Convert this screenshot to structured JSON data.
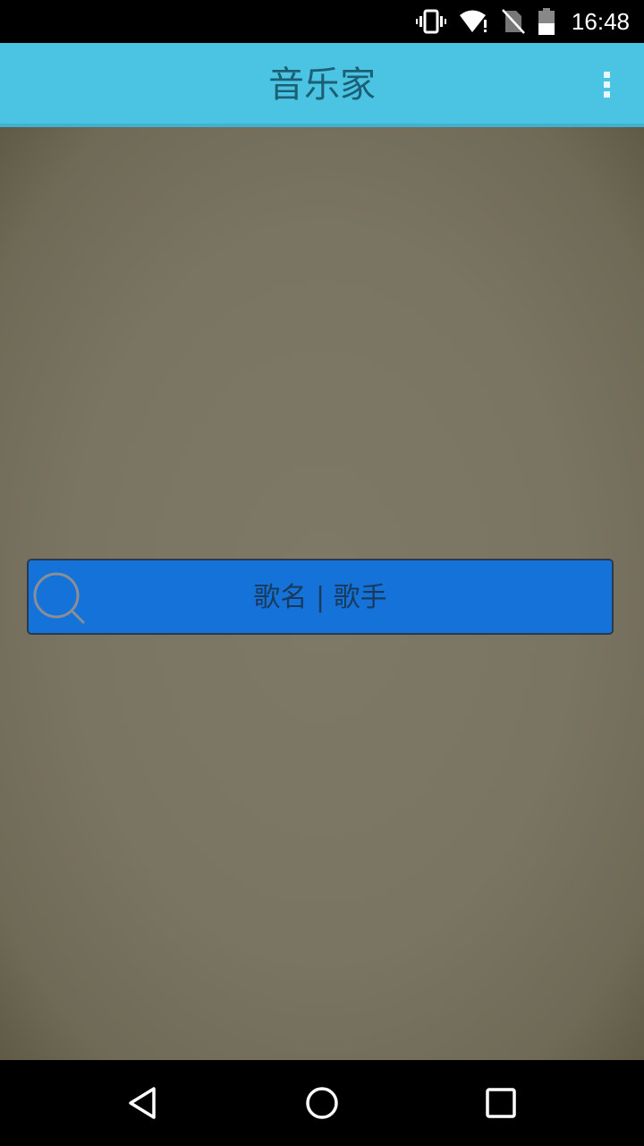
{
  "status_bar": {
    "time": "16:48",
    "icons": [
      "vibrate-icon",
      "wifi-alert-icon",
      "no-sim-icon",
      "battery-icon"
    ]
  },
  "app_bar": {
    "title": "音乐家",
    "menu_icon": "more-vert-icon"
  },
  "search": {
    "placeholder": "歌名 | 歌手",
    "icon": "search-icon"
  },
  "nav_bar": {
    "buttons": [
      "back-icon",
      "home-icon",
      "recents-icon"
    ]
  },
  "colors": {
    "app_bar": "#4ac4e2",
    "title_text": "#1c5e74",
    "search_box": "#1572d8",
    "background": "#7a7462"
  }
}
